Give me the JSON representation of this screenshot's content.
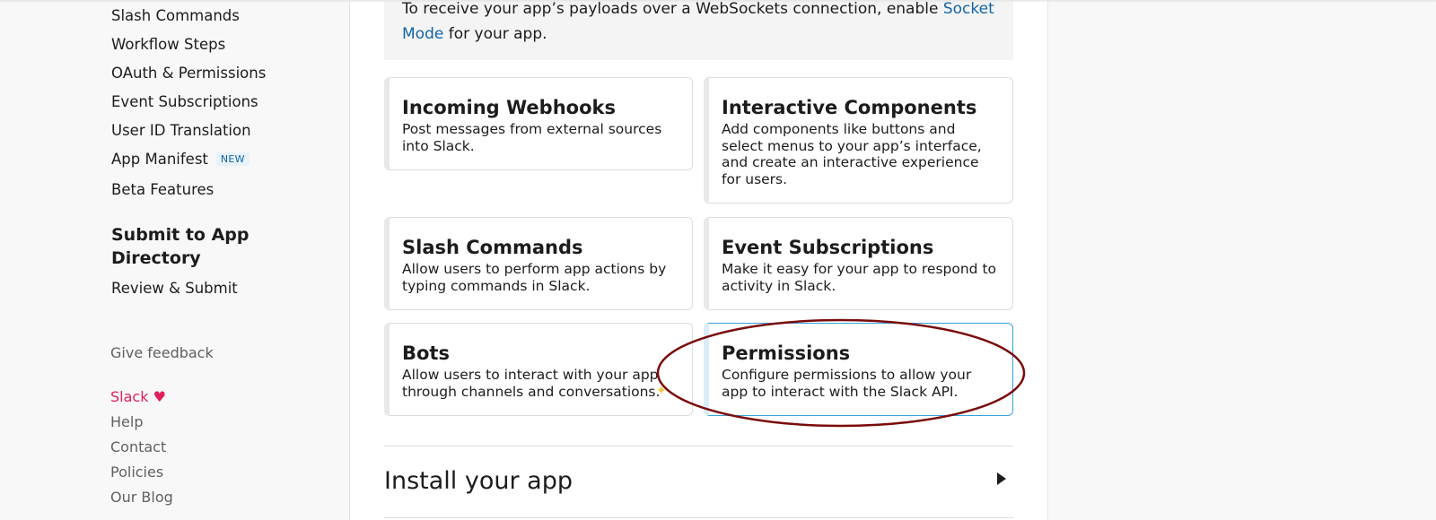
{
  "sidebar": {
    "items": [
      {
        "label": "Slash Commands"
      },
      {
        "label": "Workflow Steps"
      },
      {
        "label": "OAuth & Permissions"
      },
      {
        "label": "Event Subscriptions"
      },
      {
        "label": "User ID Translation"
      },
      {
        "label": "App Manifest",
        "badge": "NEW"
      },
      {
        "label": "Beta Features"
      }
    ],
    "section_title": "Submit to App Directory",
    "review_label": "Review & Submit",
    "feedback_label": "Give feedback",
    "footer": {
      "slack_label": "Slack",
      "heart": "♥",
      "links": [
        "Help",
        "Contact",
        "Policies",
        "Our Blog"
      ]
    }
  },
  "info": {
    "text_before": "To receive your app’s payloads over a WebSockets connection, enable ",
    "link": "Socket Mode",
    "text_after": " for your app."
  },
  "features": [
    {
      "title": "Incoming Webhooks",
      "desc": "Post messages from external sources into Slack."
    },
    {
      "title": "Interactive Components",
      "desc": "Add components like buttons and select menus to your app’s interface, and create an interactive experience for users."
    },
    {
      "title": "Slash Commands",
      "desc": "Allow users to perform app actions by typing commands in Slack."
    },
    {
      "title": "Event Subscriptions",
      "desc": "Make it easy for your app to respond to activity in Slack."
    },
    {
      "title": "Bots",
      "desc": "Allow users to interact with your app through channels and conversations."
    },
    {
      "title": "Permissions",
      "desc": "Configure permissions to allow your app to interact with the Slack API.",
      "selected": true
    }
  ],
  "install": {
    "title": "Install your app",
    "icon": "caret-right-icon"
  },
  "colors": {
    "link": "#1264a3",
    "slack_pink": "#e01e5a",
    "selected_border": "#36a1db",
    "annotation": "#7a0b0b"
  }
}
